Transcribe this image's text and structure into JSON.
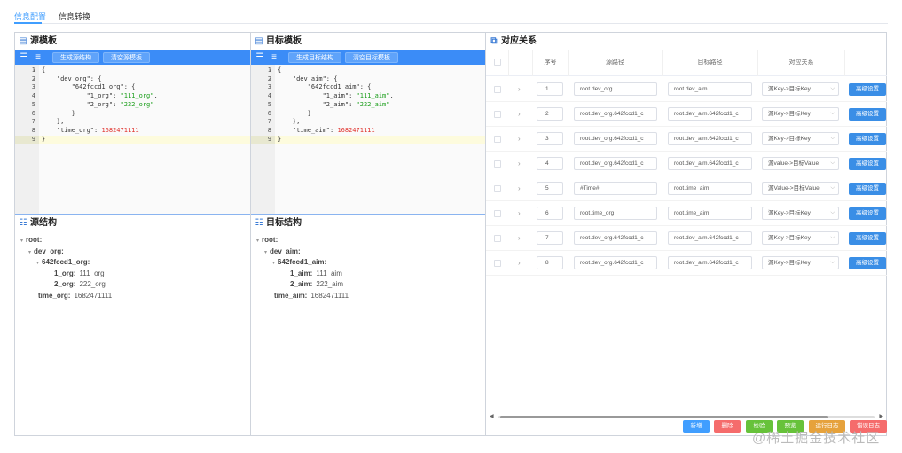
{
  "tabs": [
    {
      "label": "信息配置",
      "active": true
    },
    {
      "label": "信息转换",
      "active": false
    }
  ],
  "source_template": {
    "title": "源模板",
    "buttons": [
      "生成源结构",
      "清空源模板"
    ],
    "code_lines": [
      {
        "n": "1",
        "fold": "▾",
        "text": "{"
      },
      {
        "n": "2",
        "fold": "▾",
        "text": "    \"dev_org\": {"
      },
      {
        "n": "3",
        "fold": "▾",
        "text": "        \"642fccd1_org\": {"
      },
      {
        "n": "4",
        "fold": "",
        "text": "            \"1_org\": \"111_org\","
      },
      {
        "n": "5",
        "fold": "",
        "text": "            \"2_org\": \"222_org\""
      },
      {
        "n": "6",
        "fold": "",
        "text": "        }"
      },
      {
        "n": "7",
        "fold": "",
        "text": "    },"
      },
      {
        "n": "8",
        "fold": "",
        "text": "    \"time_org\": 1682471111"
      },
      {
        "n": "9",
        "fold": "",
        "text": "}"
      }
    ]
  },
  "target_template": {
    "title": "目标模板",
    "buttons": [
      "生成目标结构",
      "清空目标模板"
    ],
    "code_lines": [
      {
        "n": "1",
        "fold": "▾",
        "text": "{"
      },
      {
        "n": "2",
        "fold": "▾",
        "text": "    \"dev_aim\": {"
      },
      {
        "n": "3",
        "fold": "▾",
        "text": "        \"642fccd1_aim\": {"
      },
      {
        "n": "4",
        "fold": "",
        "text": "            \"1_aim\": \"111_aim\","
      },
      {
        "n": "5",
        "fold": "",
        "text": "            \"2_aim\": \"222_aim\""
      },
      {
        "n": "6",
        "fold": "",
        "text": "        }"
      },
      {
        "n": "7",
        "fold": "",
        "text": "    },"
      },
      {
        "n": "8",
        "fold": "",
        "text": "    \"time_aim\": 1682471111"
      },
      {
        "n": "9",
        "fold": "",
        "text": "}"
      }
    ]
  },
  "source_structure": {
    "title": "源结构",
    "nodes": [
      {
        "key": "root:",
        "val": "",
        "depth": 0,
        "arrow": true
      },
      {
        "key": "dev_org:",
        "val": "",
        "depth": 1,
        "arrow": true
      },
      {
        "key": "642fccd1_org:",
        "val": "",
        "depth": 2,
        "arrow": true
      },
      {
        "key": "1_org:",
        "val": "111_org",
        "depth": 3,
        "arrow": false
      },
      {
        "key": "2_org:",
        "val": "222_org",
        "depth": 3,
        "arrow": false
      },
      {
        "key": "time_org:",
        "val": "1682471111",
        "depth": 1,
        "arrow": false
      }
    ]
  },
  "target_structure": {
    "title": "目标结构",
    "nodes": [
      {
        "key": "root:",
        "val": "",
        "depth": 0,
        "arrow": true
      },
      {
        "key": "dev_aim:",
        "val": "",
        "depth": 1,
        "arrow": true
      },
      {
        "key": "642fccd1_aim:",
        "val": "",
        "depth": 2,
        "arrow": true
      },
      {
        "key": "1_aim:",
        "val": "111_aim",
        "depth": 3,
        "arrow": false
      },
      {
        "key": "2_aim:",
        "val": "222_aim",
        "depth": 3,
        "arrow": false
      },
      {
        "key": "time_aim:",
        "val": "1682471111",
        "depth": 1,
        "arrow": false
      }
    ]
  },
  "mapping": {
    "title": "对应关系",
    "headers": [
      "序号",
      "源路径",
      "目标路径",
      "对应关系"
    ],
    "advanced_label": "高级设置",
    "rows": [
      {
        "idx": "1",
        "src": "root.dev_org",
        "dst": "root.dev_aim",
        "rel": "源Key->目标Key"
      },
      {
        "idx": "2",
        "src": "root.dev_org.642fccd1_c",
        "dst": "root.dev_aim.642fccd1_c",
        "rel": "源Key->目标Key"
      },
      {
        "idx": "3",
        "src": "root.dev_org.642fccd1_c",
        "dst": "root.dev_aim.642fccd1_c",
        "rel": "源Key->目标Key"
      },
      {
        "idx": "4",
        "src": "root.dev_org.642fccd1_c",
        "dst": "root.dev_aim.642fccd1_c",
        "rel": "源value->目标Value"
      },
      {
        "idx": "5",
        "src": "#Time#",
        "dst": "root.time_aim",
        "rel": "源Value->目标Value"
      },
      {
        "idx": "6",
        "src": "root.time_org",
        "dst": "root.time_aim",
        "rel": "源Key->目标Key"
      },
      {
        "idx": "7",
        "src": "root.dev_org.642fccd1_c",
        "dst": "root.dev_aim.642fccd1_c",
        "rel": "源Key->目标Key"
      },
      {
        "idx": "8",
        "src": "root.dev_org.642fccd1_c",
        "dst": "root.dev_aim.642fccd1_c",
        "rel": "源Key->目标Key"
      }
    ]
  },
  "bottom_buttons": [
    {
      "label": "新增",
      "color": "#409eff"
    },
    {
      "label": "删除",
      "color": "#f56c6c"
    },
    {
      "label": "检验",
      "color": "#67c23a"
    },
    {
      "label": "预览",
      "color": "#67c23a"
    },
    {
      "label": "运行日志",
      "color": "#e6a23c"
    },
    {
      "label": "错误日志",
      "color": "#f56c6c"
    }
  ],
  "watermark": "@稀土掘金技术社区"
}
